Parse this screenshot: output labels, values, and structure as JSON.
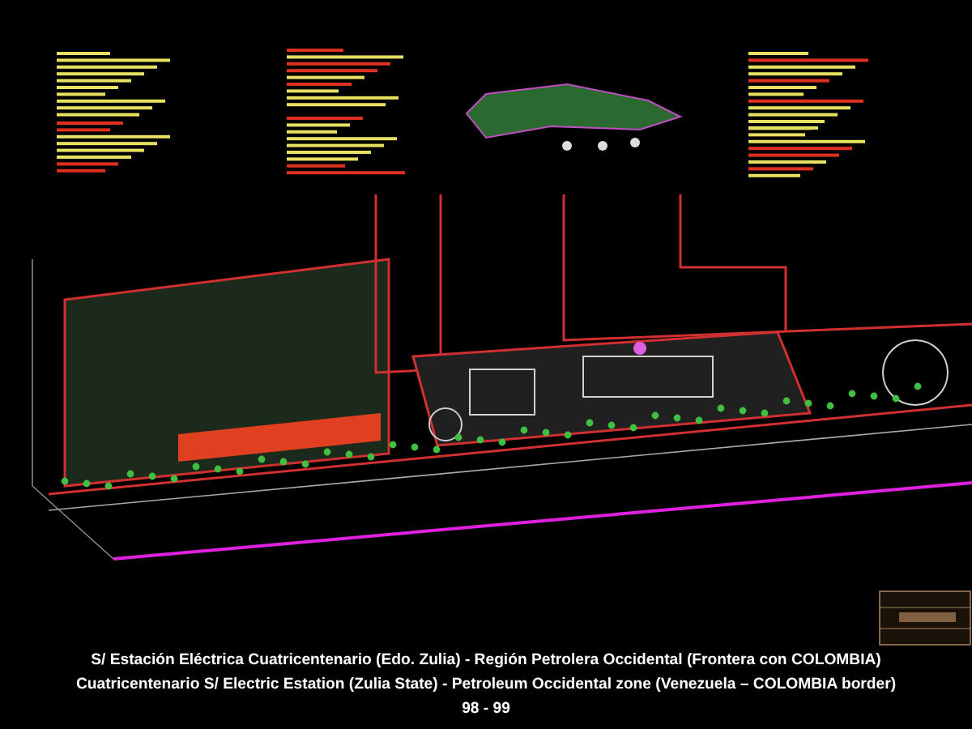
{
  "caption": {
    "lines": [
      "S/ Estación Eléctrica Cuatricentenario (Edo. Zulia) - Región Petrolera Occidental (Frontera con COLOMBIA)",
      "Cuatricentenario S/ Electric Estation (Zulia State) - Petroleum Occidental zone (Venezuela – COLOMBIA border)",
      "98 - 99"
    ]
  }
}
